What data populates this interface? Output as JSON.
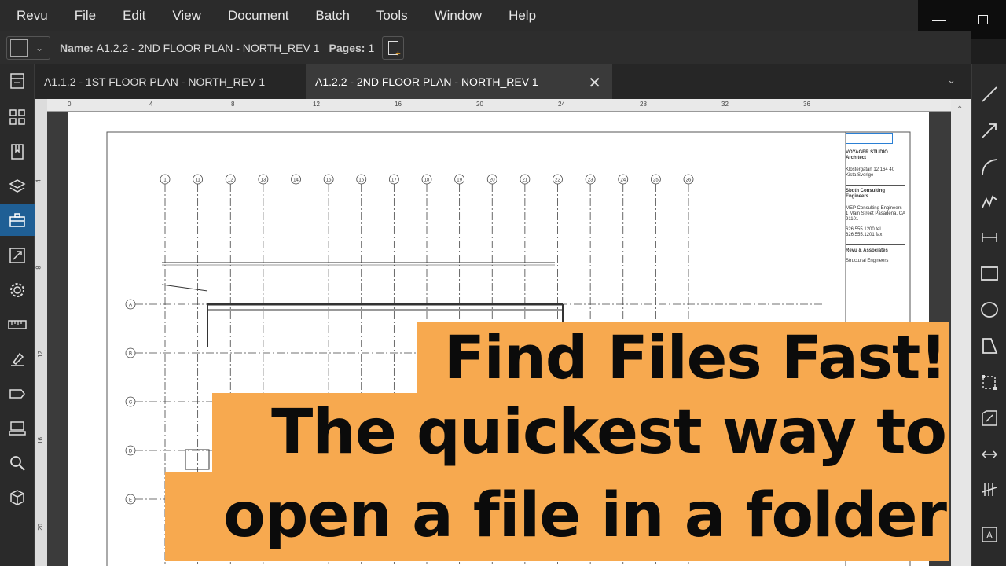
{
  "menubar": {
    "items": [
      "Revu",
      "File",
      "Edit",
      "View",
      "Document",
      "Batch",
      "Tools",
      "Window",
      "Help"
    ]
  },
  "window_controls": {
    "minimize": "—"
  },
  "toolbar": {
    "name_label": "Name:",
    "name_value": "A1.2.2 - 2ND FLOOR PLAN - NORTH_REV 1",
    "pages_label": "Pages:",
    "pages_value": "1"
  },
  "tabs": [
    {
      "label": "A1.1.2 - 1ST FLOOR PLAN - NORTH_REV 1",
      "active": false
    },
    {
      "label": "A1.2.2 - 2ND FLOOR PLAN - NORTH_REV 1",
      "active": true
    }
  ],
  "ruler_ticks": [
    "0",
    "4",
    "8",
    "12",
    "16",
    "20",
    "24",
    "28",
    "32",
    "36"
  ],
  "vruler_ticks": [
    "4",
    "8",
    "12",
    "16",
    "20"
  ],
  "drawing": {
    "title_block": {
      "firm": "VOYAGER STUDIO Architect",
      "address": "Klostergatan 12 164 40 Kista Sverige",
      "consultant": "Sbdth Consulting Engineers",
      "mep": "MEP Consulting Engineers 1 Main Street Pasadena, CA 91101",
      "phone": "626.555.1200 tel 626.555.1201 fax",
      "revu": "Revu & Associates",
      "structural": "Structural Engineers"
    },
    "grid_bubbles_top": [
      "1",
      "11",
      "12",
      "13",
      "14",
      "15",
      "16",
      "17",
      "18",
      "19",
      "20",
      "21",
      "22",
      "23",
      "24",
      "25",
      "26"
    ],
    "grid_bubbles_left": [
      "A",
      "B",
      "C",
      "D",
      "E"
    ]
  },
  "overlay": {
    "line1": "Find Files Fast!",
    "line2": "The quickest way to",
    "line3": "open a file in a folder"
  },
  "colors": {
    "accent": "#1f5f95",
    "overlay_bg": "#f7a94f",
    "new_doc_plus": "#f5a623"
  },
  "left_icons": [
    "panels-icon",
    "thumbnails-icon",
    "bookmarks-icon",
    "layers-icon",
    "toolbox-icon",
    "studio-icon",
    "properties-icon",
    "measurements-icon",
    "signatures-icon",
    "tags-icon",
    "stamp-icon",
    "search-icon",
    "3d-icon"
  ],
  "right_icons": [
    "line-icon",
    "arrow-icon",
    "arc-icon",
    "polyline-icon",
    "dimension-icon",
    "rectangle-icon",
    "ellipse-icon",
    "polygon-icon",
    "area-icon",
    "cutout-icon",
    "length-icon",
    "count-icon",
    "text-box-icon"
  ]
}
